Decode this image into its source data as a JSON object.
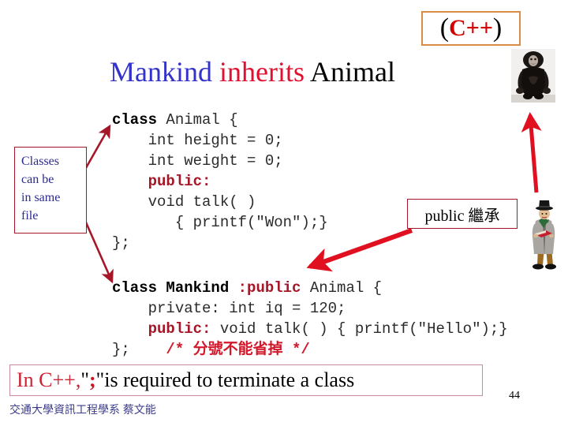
{
  "slide": {
    "badge": {
      "open_paren": "(",
      "label": "C++",
      "close_paren": ")"
    },
    "title": {
      "word1": "Mankind",
      "word2": "inherits",
      "word3": "Animal"
    },
    "page_number": "44",
    "footer": "交通大學資訊工程學系 蔡文能"
  },
  "code_animal": {
    "line1_kw": "class",
    "line1_rest": " Animal {",
    "line2": "    int height = 0;",
    "line3": "    int weight = 0;",
    "line4_kw": "    public:",
    "line5": "    void talk( )",
    "line6": "       { printf(\"Won\");}",
    "line7_brace": "};",
    "line7_semi": ""
  },
  "code_mankind": {
    "line1_kw": "class Mankind",
    "line1_pub": " :public",
    "line1_rest": " Animal {",
    "line2": "    private: int iq = 120;",
    "line3_kw": "    public:",
    "line3_rest": " void talk( ) { printf(\"Hello\");}",
    "line4_brace": "};",
    "line4_comment": "    /* 分號不能省掉 */"
  },
  "callouts": {
    "classes_box": "Classes can be in same file",
    "classes_box_lines": [
      "Classes",
      "can be",
      "in same",
      "file"
    ],
    "public_box": "public 繼承"
  },
  "banner": {
    "part1": "In C++, ",
    "quote_open": "\"",
    "semicolon": ";",
    "quote_close": "\"",
    "part2": " is required to terminate a class"
  },
  "images": {
    "gorilla": "gorilla-photo",
    "gentleman": "gentleman-illustration"
  },
  "colors": {
    "title_blue": "#3333cc",
    "title_red": "#e01030",
    "keyword_red": "#a51728",
    "arrow_red": "#d2182b",
    "box_border": "#a51728",
    "badge_border": "#d98c45",
    "footer_blue": "#3b3b8c"
  }
}
